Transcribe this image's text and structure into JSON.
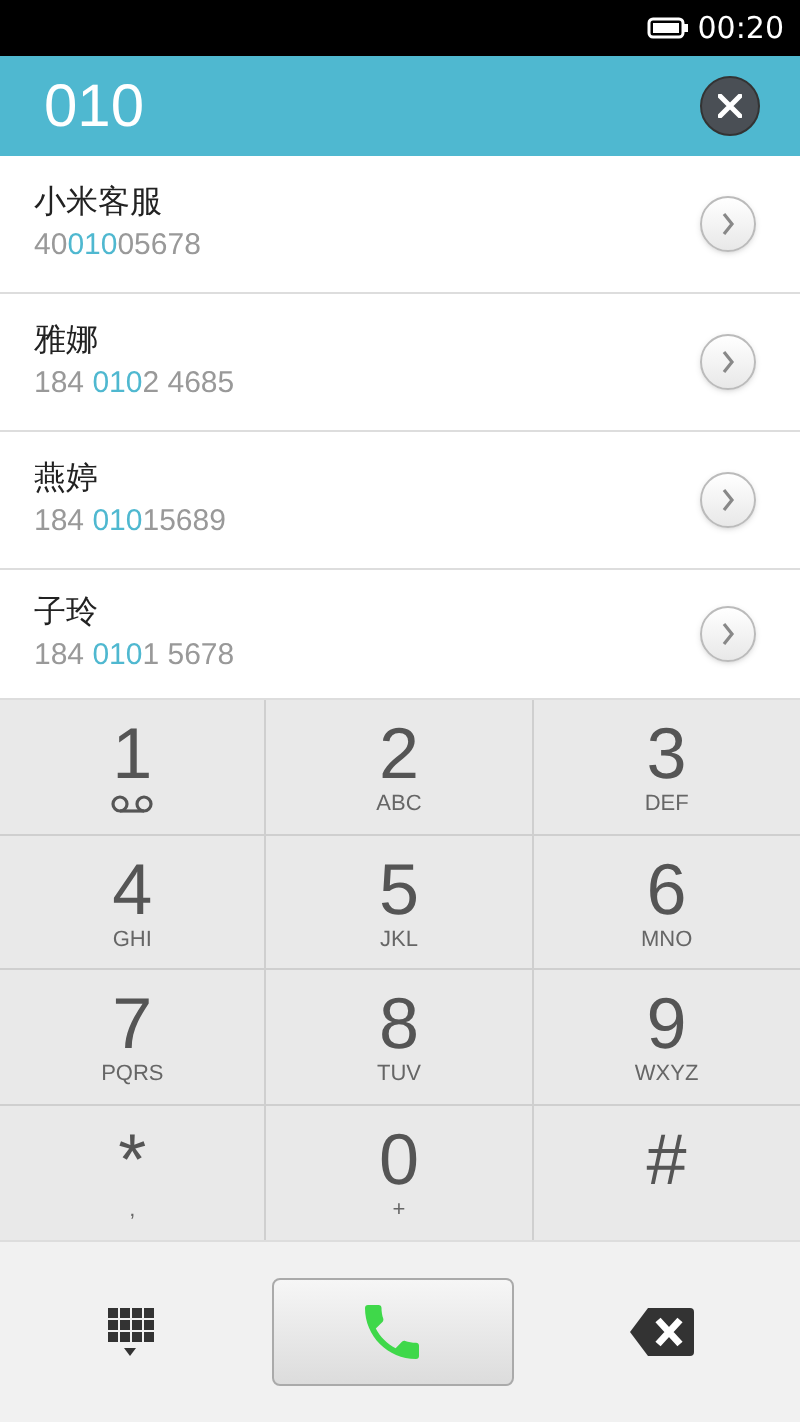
{
  "status_bar": {
    "time": "00:20"
  },
  "search": {
    "value": "010"
  },
  "results": [
    {
      "name": "小米客服",
      "number": {
        "before": "40",
        "match": "010",
        "after": "05678"
      }
    },
    {
      "name": "雅娜",
      "number": {
        "before": "184 ",
        "match": "010",
        "after": "2 4685"
      }
    },
    {
      "name": "燕婷",
      "number": {
        "before": "184 ",
        "match": "010",
        "after": "15689"
      }
    },
    {
      "name": "子玲",
      "number": {
        "before": "184 ",
        "match": "010",
        "after": "1 5678"
      }
    }
  ],
  "keypad": [
    {
      "digit": "1",
      "kind": "voicemail"
    },
    {
      "digit": "2",
      "kind": "letters",
      "letters": "ABC"
    },
    {
      "digit": "3",
      "kind": "letters",
      "letters": "DEF"
    },
    {
      "digit": "4",
      "kind": "letters",
      "letters": "GHI"
    },
    {
      "digit": "5",
      "kind": "letters",
      "letters": "JKL"
    },
    {
      "digit": "6",
      "kind": "letters",
      "letters": "MNO"
    },
    {
      "digit": "7",
      "kind": "letters",
      "letters": "PQRS"
    },
    {
      "digit": "8",
      "kind": "letters",
      "letters": "TUV"
    },
    {
      "digit": "9",
      "kind": "letters",
      "letters": "WXYZ"
    },
    {
      "digit": "*",
      "kind": "letters",
      "letters": ","
    },
    {
      "digit": "0",
      "kind": "letters",
      "letters": "+"
    },
    {
      "digit": "#",
      "kind": "plain"
    }
  ]
}
